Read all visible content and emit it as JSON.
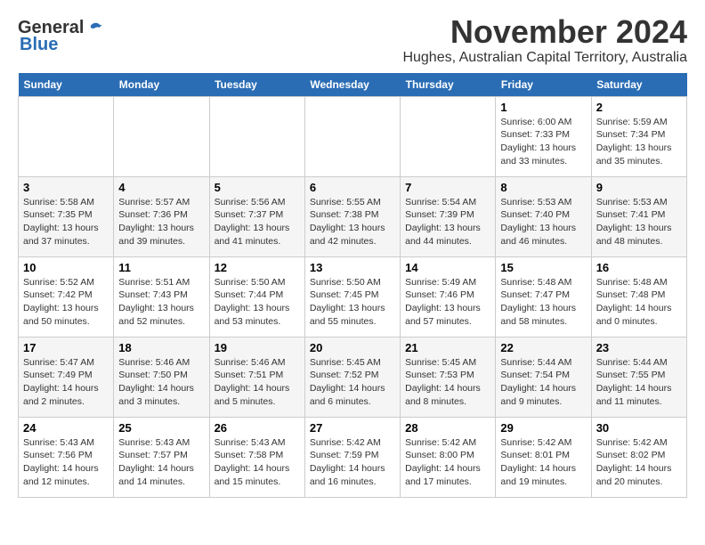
{
  "logo": {
    "general": "General",
    "blue": "Blue"
  },
  "title": "November 2024",
  "location": "Hughes, Australian Capital Territory, Australia",
  "days_header": [
    "Sunday",
    "Monday",
    "Tuesday",
    "Wednesday",
    "Thursday",
    "Friday",
    "Saturday"
  ],
  "weeks": [
    [
      {
        "day": "",
        "info": ""
      },
      {
        "day": "",
        "info": ""
      },
      {
        "day": "",
        "info": ""
      },
      {
        "day": "",
        "info": ""
      },
      {
        "day": "",
        "info": ""
      },
      {
        "day": "1",
        "info": "Sunrise: 6:00 AM\nSunset: 7:33 PM\nDaylight: 13 hours\nand 33 minutes."
      },
      {
        "day": "2",
        "info": "Sunrise: 5:59 AM\nSunset: 7:34 PM\nDaylight: 13 hours\nand 35 minutes."
      }
    ],
    [
      {
        "day": "3",
        "info": "Sunrise: 5:58 AM\nSunset: 7:35 PM\nDaylight: 13 hours\nand 37 minutes."
      },
      {
        "day": "4",
        "info": "Sunrise: 5:57 AM\nSunset: 7:36 PM\nDaylight: 13 hours\nand 39 minutes."
      },
      {
        "day": "5",
        "info": "Sunrise: 5:56 AM\nSunset: 7:37 PM\nDaylight: 13 hours\nand 41 minutes."
      },
      {
        "day": "6",
        "info": "Sunrise: 5:55 AM\nSunset: 7:38 PM\nDaylight: 13 hours\nand 42 minutes."
      },
      {
        "day": "7",
        "info": "Sunrise: 5:54 AM\nSunset: 7:39 PM\nDaylight: 13 hours\nand 44 minutes."
      },
      {
        "day": "8",
        "info": "Sunrise: 5:53 AM\nSunset: 7:40 PM\nDaylight: 13 hours\nand 46 minutes."
      },
      {
        "day": "9",
        "info": "Sunrise: 5:53 AM\nSunset: 7:41 PM\nDaylight: 13 hours\nand 48 minutes."
      }
    ],
    [
      {
        "day": "10",
        "info": "Sunrise: 5:52 AM\nSunset: 7:42 PM\nDaylight: 13 hours\nand 50 minutes."
      },
      {
        "day": "11",
        "info": "Sunrise: 5:51 AM\nSunset: 7:43 PM\nDaylight: 13 hours\nand 52 minutes."
      },
      {
        "day": "12",
        "info": "Sunrise: 5:50 AM\nSunset: 7:44 PM\nDaylight: 13 hours\nand 53 minutes."
      },
      {
        "day": "13",
        "info": "Sunrise: 5:50 AM\nSunset: 7:45 PM\nDaylight: 13 hours\nand 55 minutes."
      },
      {
        "day": "14",
        "info": "Sunrise: 5:49 AM\nSunset: 7:46 PM\nDaylight: 13 hours\nand 57 minutes."
      },
      {
        "day": "15",
        "info": "Sunrise: 5:48 AM\nSunset: 7:47 PM\nDaylight: 13 hours\nand 58 minutes."
      },
      {
        "day": "16",
        "info": "Sunrise: 5:48 AM\nSunset: 7:48 PM\nDaylight: 14 hours\nand 0 minutes."
      }
    ],
    [
      {
        "day": "17",
        "info": "Sunrise: 5:47 AM\nSunset: 7:49 PM\nDaylight: 14 hours\nand 2 minutes."
      },
      {
        "day": "18",
        "info": "Sunrise: 5:46 AM\nSunset: 7:50 PM\nDaylight: 14 hours\nand 3 minutes."
      },
      {
        "day": "19",
        "info": "Sunrise: 5:46 AM\nSunset: 7:51 PM\nDaylight: 14 hours\nand 5 minutes."
      },
      {
        "day": "20",
        "info": "Sunrise: 5:45 AM\nSunset: 7:52 PM\nDaylight: 14 hours\nand 6 minutes."
      },
      {
        "day": "21",
        "info": "Sunrise: 5:45 AM\nSunset: 7:53 PM\nDaylight: 14 hours\nand 8 minutes."
      },
      {
        "day": "22",
        "info": "Sunrise: 5:44 AM\nSunset: 7:54 PM\nDaylight: 14 hours\nand 9 minutes."
      },
      {
        "day": "23",
        "info": "Sunrise: 5:44 AM\nSunset: 7:55 PM\nDaylight: 14 hours\nand 11 minutes."
      }
    ],
    [
      {
        "day": "24",
        "info": "Sunrise: 5:43 AM\nSunset: 7:56 PM\nDaylight: 14 hours\nand 12 minutes."
      },
      {
        "day": "25",
        "info": "Sunrise: 5:43 AM\nSunset: 7:57 PM\nDaylight: 14 hours\nand 14 minutes."
      },
      {
        "day": "26",
        "info": "Sunrise: 5:43 AM\nSunset: 7:58 PM\nDaylight: 14 hours\nand 15 minutes."
      },
      {
        "day": "27",
        "info": "Sunrise: 5:42 AM\nSunset: 7:59 PM\nDaylight: 14 hours\nand 16 minutes."
      },
      {
        "day": "28",
        "info": "Sunrise: 5:42 AM\nSunset: 8:00 PM\nDaylight: 14 hours\nand 17 minutes."
      },
      {
        "day": "29",
        "info": "Sunrise: 5:42 AM\nSunset: 8:01 PM\nDaylight: 14 hours\nand 19 minutes."
      },
      {
        "day": "30",
        "info": "Sunrise: 5:42 AM\nSunset: 8:02 PM\nDaylight: 14 hours\nand 20 minutes."
      }
    ]
  ]
}
